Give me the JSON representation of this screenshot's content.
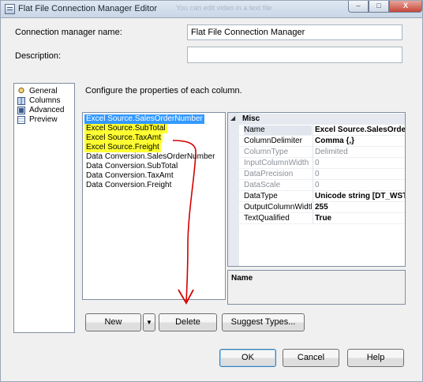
{
  "window": {
    "title": "Flat File Connection Manager Editor",
    "title_watermark": "You can edit video in a text file",
    "controls": {
      "minimize": "–",
      "maximize": "□",
      "close": "X"
    }
  },
  "form": {
    "name_label": "Connection manager name:",
    "name_value": "Flat File Connection Manager",
    "description_label": "Description:",
    "description_value": ""
  },
  "nav": {
    "items": [
      {
        "label": "General",
        "icon": "general-icon"
      },
      {
        "label": "Columns",
        "icon": "columns-icon"
      },
      {
        "label": "Advanced",
        "icon": "advanced-icon"
      },
      {
        "label": "Preview",
        "icon": "preview-icon"
      }
    ],
    "selected": "Advanced"
  },
  "instruction": "Configure the properties of each column.",
  "columns": [
    {
      "label": "Excel Source.SalesOrderNumber",
      "state": "selected"
    },
    {
      "label": "Excel Source.SubTotal",
      "state": "highlighted"
    },
    {
      "label": "Excel Source.TaxAmt",
      "state": "highlighted"
    },
    {
      "label": "Excel Source.Freight",
      "state": "highlighted"
    },
    {
      "label": "Data Conversion.SalesOrderNumber",
      "state": "normal"
    },
    {
      "label": "Data Conversion.SubTotal",
      "state": "normal"
    },
    {
      "label": "Data Conversion.TaxAmt",
      "state": "normal"
    },
    {
      "label": "Data Conversion.Freight",
      "state": "normal"
    }
  ],
  "properties": {
    "category": "Misc",
    "rows": [
      {
        "name": "Name",
        "value": "Excel Source.SalesOrderNumber"
      },
      {
        "name": "ColumnDelimiter",
        "value": "Comma {,}"
      },
      {
        "name": "ColumnType",
        "value": "Delimited"
      },
      {
        "name": "InputColumnWidth",
        "value": "0"
      },
      {
        "name": "DataPrecision",
        "value": "0"
      },
      {
        "name": "DataScale",
        "value": "0"
      },
      {
        "name": "DataType",
        "value": "Unicode string [DT_WSTR]"
      },
      {
        "name": "OutputColumnWidth",
        "value": "255"
      },
      {
        "name": "TextQualified",
        "value": "True"
      }
    ],
    "description_title": "Name"
  },
  "buttons": {
    "new": "New",
    "new_dropdown": "▼",
    "delete": "Delete",
    "suggest_types": "Suggest Types...",
    "ok": "OK",
    "cancel": "Cancel",
    "help": "Help"
  },
  "annotation_color": "#d40000",
  "highlight_color": "#ffff33",
  "selection_color": "#3399ff"
}
